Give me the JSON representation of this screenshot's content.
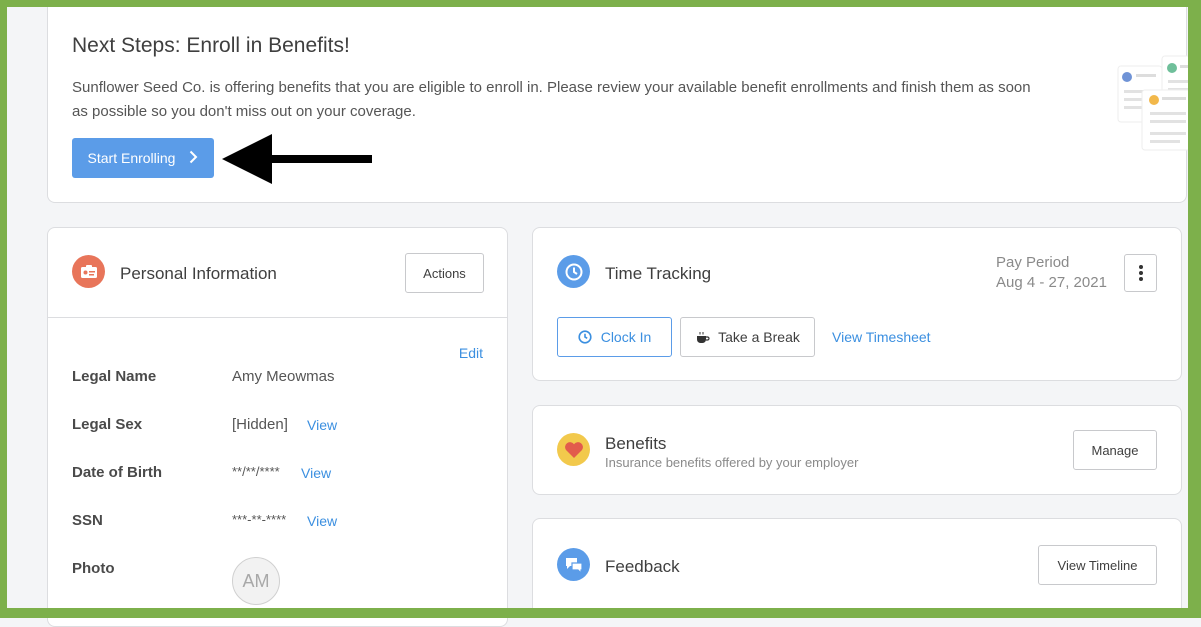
{
  "banner": {
    "title": "Next Steps: Enroll in Benefits!",
    "text": "Sunflower Seed Co. is offering benefits that you are eligible to enroll in. Please review your available benefit enrollments and finish them as soon as possible so you don't miss out on your coverage.",
    "button_label": "Start Enrolling",
    "illustration_icon": "benefit-documents-illustration"
  },
  "personal": {
    "title": "Personal Information",
    "icon": "id-card-icon",
    "actions_label": "Actions",
    "edit_label": "Edit",
    "fields": [
      {
        "label": "Legal Name",
        "value": "Amy Meowmas",
        "view": ""
      },
      {
        "label": "Legal Sex",
        "value": "[Hidden]",
        "view": "View"
      },
      {
        "label": "Date of Birth",
        "value": "**/**/****",
        "view": "View"
      },
      {
        "label": "SSN",
        "value": "***-**-****",
        "view": "View"
      },
      {
        "label": "Photo",
        "value": "",
        "view": ""
      }
    ],
    "avatar_initials": "AM"
  },
  "time": {
    "title": "Time Tracking",
    "icon": "clock-icon",
    "pay_period_label": "Pay Period",
    "pay_period_dates": "Aug 4 - 27, 2021",
    "clock_in_label": "Clock In",
    "break_label": "Take a Break",
    "timesheet_label": "View Timesheet"
  },
  "benefits": {
    "title": "Benefits",
    "subtitle": "Insurance benefits offered by your employer",
    "icon": "heart-icon",
    "manage_label": "Manage"
  },
  "feedback": {
    "title": "Feedback",
    "icon": "chat-bubbles-icon",
    "timeline_label": "View Timeline"
  },
  "colors": {
    "primary": "#5b9ce8",
    "link": "#3b8fe0",
    "frame": "#7db04b",
    "personal_icon_bg": "#e8755a",
    "time_icon_bg": "#5b9ce8",
    "benefits_icon_bg": "#f2c94c",
    "feedback_icon_bg": "#5b9ce8"
  }
}
